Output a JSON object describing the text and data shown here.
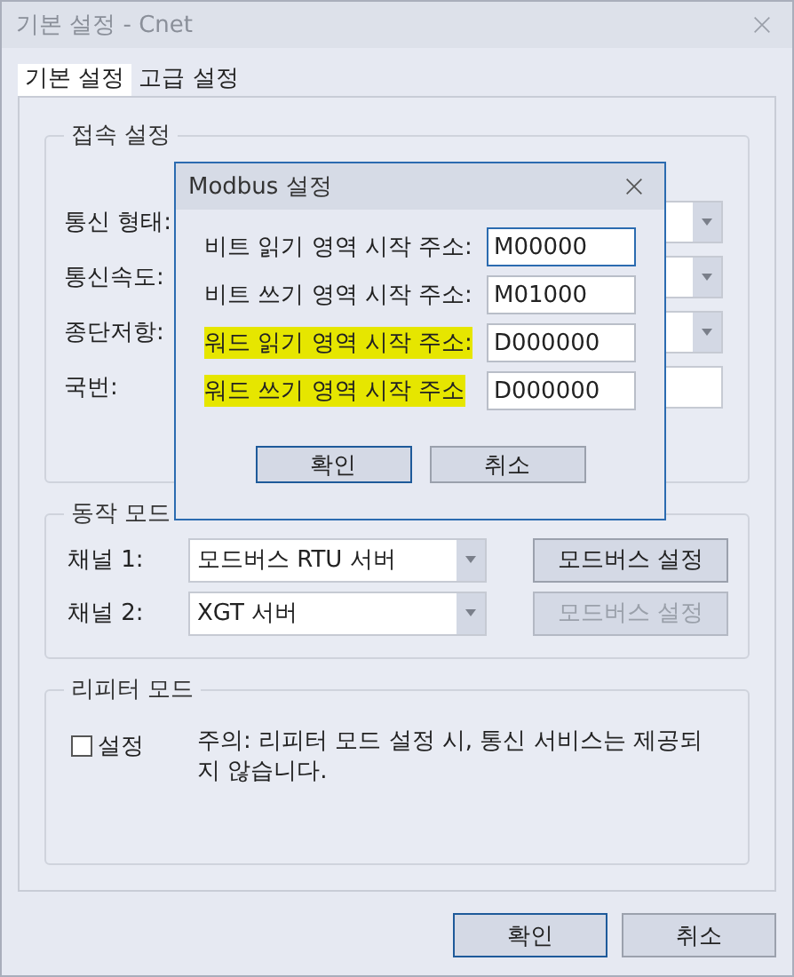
{
  "window": {
    "title": "기본 설정 - Cnet"
  },
  "tabs": [
    {
      "label": "기본 설정",
      "selected": true
    },
    {
      "label": "고급 설정",
      "selected": false
    }
  ],
  "connection": {
    "title": "접속 설정",
    "rows": [
      {
        "label": "통신 형태:",
        "kind": "combo"
      },
      {
        "label": "통신속도:",
        "kind": "combo"
      },
      {
        "label": "종단저항:",
        "kind": "combo"
      },
      {
        "label": "국번:",
        "kind": "input"
      }
    ]
  },
  "operation_mode": {
    "title": "동작 모드",
    "channels": [
      {
        "label": "채널 1:",
        "value": "모드버스 RTU 서버",
        "button": "모드버스 설정",
        "disabled": false
      },
      {
        "label": "채널 2:",
        "value": "XGT 서버",
        "button": "모드버스 설정",
        "disabled": true
      }
    ]
  },
  "repeater_mode": {
    "title": "리피터 모드",
    "checkbox": {
      "label": "설정",
      "checked": false
    },
    "note": "주의: 리피터 모드 설정 시, 통신 서비스는 제공되지 않습니다."
  },
  "buttons": [
    {
      "label": "확인",
      "default": true
    },
    {
      "label": "취소",
      "default": false
    }
  ],
  "modbus_dialog": {
    "title": "Modbus 설정",
    "fields": [
      {
        "label": "비트 읽기 영역 시작 주소:",
        "value": "M00000",
        "focused": true,
        "highlighted": false
      },
      {
        "label": "비트 쓰기 영역 시작 주소:",
        "value": "M01000",
        "focused": false,
        "highlighted": false
      },
      {
        "label": "워드 읽기 영역 시작 주소:",
        "value": "D000000",
        "focused": false,
        "highlighted": true
      },
      {
        "label": "워드 쓰기 영역 시작 주소",
        "value": "D000000",
        "focused": false,
        "highlighted": true
      }
    ],
    "buttons": [
      {
        "label": "확인",
        "default": true
      },
      {
        "label": "취소",
        "default": false
      }
    ]
  }
}
